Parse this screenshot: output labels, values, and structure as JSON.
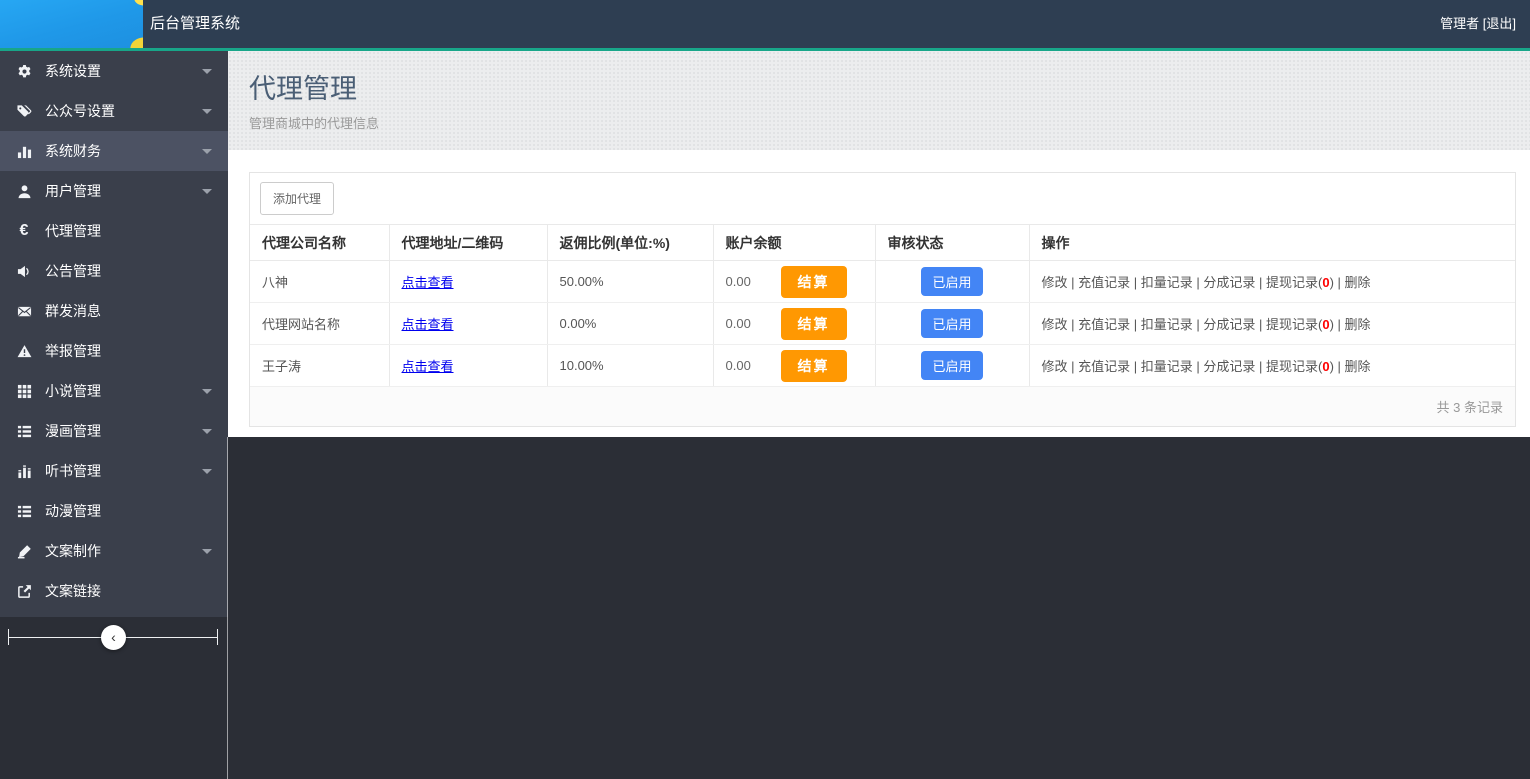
{
  "navbar": {
    "title": "后台管理系统",
    "user_label": "管理者 [退出]"
  },
  "sidebar": {
    "items": [
      {
        "key": "system-settings",
        "label": "系统设置",
        "icon": "gear-icon",
        "caret": true,
        "active": false
      },
      {
        "key": "official-account-settings",
        "label": "公众号设置",
        "icon": "tags-icon",
        "caret": true,
        "active": false
      },
      {
        "key": "system-finance",
        "label": "系统财务",
        "icon": "bar-chart-icon",
        "caret": true,
        "active": true
      },
      {
        "key": "user-management",
        "label": "用户管理",
        "icon": "user-icon",
        "caret": true,
        "active": false
      },
      {
        "key": "agent-management",
        "label": "代理管理",
        "icon": "euro-icon",
        "caret": false,
        "active": false
      },
      {
        "key": "announcement-management",
        "label": "公告管理",
        "icon": "speaker-icon",
        "caret": false,
        "active": false
      },
      {
        "key": "bulk-message",
        "label": "群发消息",
        "icon": "envelope-icon",
        "caret": false,
        "active": false
      },
      {
        "key": "report-management",
        "label": "举报管理",
        "icon": "warning-icon",
        "caret": false,
        "active": false
      },
      {
        "key": "novel-management",
        "label": "小说管理",
        "icon": "grid-icon",
        "caret": true,
        "active": false
      },
      {
        "key": "comic-management",
        "label": "漫画管理",
        "icon": "list-icon",
        "caret": true,
        "active": false
      },
      {
        "key": "audiobook-management",
        "label": "听书管理",
        "icon": "equalizer-icon",
        "caret": true,
        "active": false
      },
      {
        "key": "animation-management",
        "label": "动漫管理",
        "icon": "list-icon",
        "caret": false,
        "active": false
      },
      {
        "key": "copywriting-production",
        "label": "文案制作",
        "icon": "pen-icon",
        "caret": true,
        "active": false
      },
      {
        "key": "copywriting-link",
        "label": "文案链接",
        "icon": "share-icon",
        "caret": false,
        "active": false
      }
    ]
  },
  "page": {
    "title": "代理管理",
    "subtitle": "管理商城中的代理信息"
  },
  "toolbar": {
    "add_button": "添加代理"
  },
  "table": {
    "columns": [
      "代理公司名称",
      "代理地址/二维码",
      "返佣比例(单位:%)",
      "账户余额",
      "审核状态",
      "操作"
    ],
    "settle_label": "结算",
    "status_label": "已启用",
    "operations": {
      "links": [
        "修改",
        "充值记录",
        "扣量记录",
        "分成记录"
      ],
      "withdraw_label": "提现记录",
      "delete_label": "删除",
      "separator": " | "
    },
    "rows": [
      {
        "company": "八神",
        "qrcode_link": "点击查看",
        "ratio": "50.00%",
        "balance": "0.00",
        "withdraw_count": "0"
      },
      {
        "company": "代理网站名称",
        "qrcode_link": "点击查看",
        "ratio": "0.00%",
        "balance": "0.00",
        "withdraw_count": "0"
      },
      {
        "company": "王子涛",
        "qrcode_link": "点击查看",
        "ratio": "10.00%",
        "balance": "0.00",
        "withdraw_count": "0"
      }
    ],
    "footer": "共 3 条记录"
  },
  "colors": {
    "accent_teal": "#18A689",
    "navbar_bg": "#2E3E52",
    "sidebar_bg": "#3A3F4B",
    "sidebar_active_bg": "#4C5263",
    "page_dark_bg": "#2B2E36",
    "header_band_bg": "#ECEDEE",
    "title_color": "#4A5E75",
    "orange_button": "#FF9802",
    "blue_button": "#4385F5",
    "link_blue": "#0000EE",
    "count_red": "#FF0000",
    "logo_blue": "#1F98E8"
  }
}
